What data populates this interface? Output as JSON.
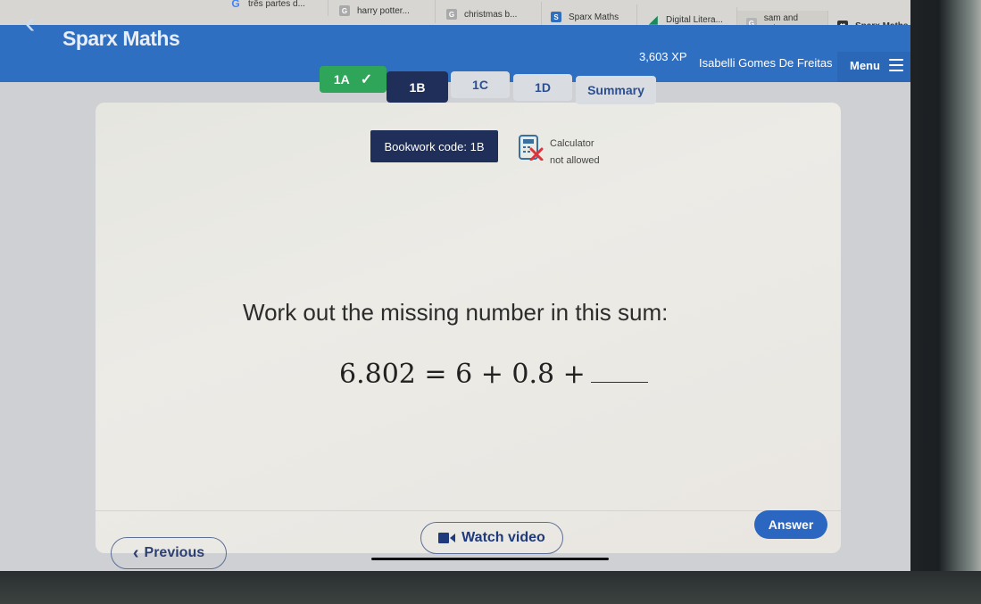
{
  "browser_tabs": [
    {
      "label": "três partes d...",
      "icon": "google-icon",
      "icon_color": "#4285f4"
    },
    {
      "label": "harry potter...",
      "icon": "doc-icon",
      "icon_color": "#9e9e9e"
    },
    {
      "label": "christmas b...",
      "icon": "doc-icon",
      "icon_color": "#9e9e9e"
    },
    {
      "label": "Sparx Maths",
      "icon": "sparx-icon",
      "icon_color": "#2f6fc2"
    },
    {
      "label": "Digital Litera...",
      "icon": "digital-literacy-icon",
      "icon_color": "#1b8a5a"
    },
    {
      "label": "sam and cat...",
      "icon": "doc-icon",
      "icon_color": "#9e9e9e"
    },
    {
      "label": "Sparx Maths",
      "icon": "sparx-x-icon",
      "icon_color": "#333333",
      "active": true
    }
  ],
  "header": {
    "back_icon": "chevron-left-icon",
    "title": "Sparx Maths",
    "xp": "3,603 XP",
    "user_name": "Isabelli Gomes De Freitas",
    "menu_label": "Menu",
    "menu_icon": "hamburger-icon"
  },
  "question_tabs": [
    {
      "label": "1A",
      "state": "completed",
      "icon": "check-icon"
    },
    {
      "label": "1B",
      "state": "active"
    },
    {
      "label": "1C",
      "state": "default"
    },
    {
      "label": "1D",
      "state": "default"
    },
    {
      "label": "Summary",
      "state": "default"
    }
  ],
  "card": {
    "bookwork_code": "Bookwork code: 1B",
    "calculator_line1": "Calculator",
    "calculator_line2": "not allowed",
    "question_text": "Work out the missing number in this sum:",
    "equation": "6.802 = 6 + 0.8 +"
  },
  "buttons": {
    "previous": "Previous",
    "watch_video": "Watch video",
    "answer": "Answer"
  },
  "colors": {
    "brand_blue": "#2f6fc2",
    "completed_green": "#2fa55a",
    "active_navy": "#1f2f5a",
    "tab_grey": "#d9dde2",
    "tab_text_blue": "#2c4f93"
  }
}
